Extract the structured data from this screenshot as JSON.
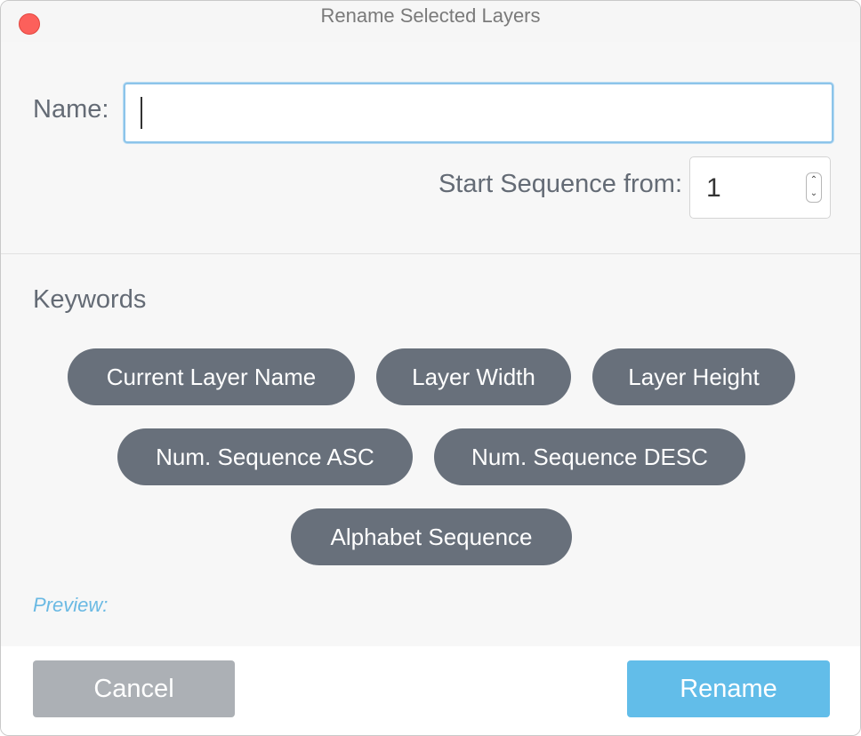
{
  "window": {
    "title": "Rename Selected Layers"
  },
  "name_field": {
    "label": "Name:",
    "value": "",
    "placeholder": ""
  },
  "sequence": {
    "label": "Start Sequence from:",
    "value": "1"
  },
  "keywords": {
    "heading": "Keywords",
    "items": [
      "Current Layer Name",
      "Layer Width",
      "Layer Height",
      "Num. Sequence ASC",
      "Num. Sequence DESC",
      "Alphabet Sequence"
    ]
  },
  "preview": {
    "label": "Preview:"
  },
  "buttons": {
    "cancel": "Cancel",
    "rename": "Rename"
  },
  "colors": {
    "accent": "#62bde9",
    "pill": "#68707b",
    "cancel": "#acb0b5",
    "close": "#fc605b"
  },
  "icons": {
    "close": "close-dot-icon",
    "stepper_up": "chevron-up-icon",
    "stepper_down": "chevron-down-icon"
  }
}
